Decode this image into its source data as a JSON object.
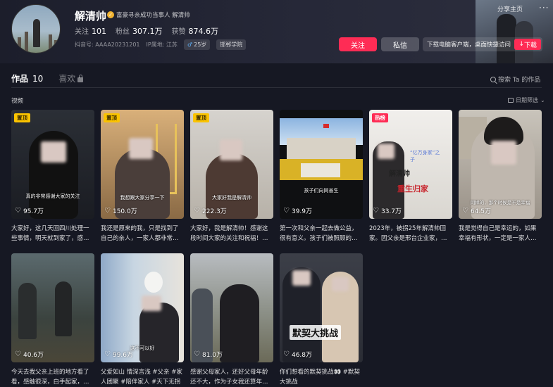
{
  "profile": {
    "name": "解清帅",
    "verified_text": "寻亲成功当事人 解清帅",
    "verified_prefix": "富豪寻亲成功当事人 解清帅",
    "follow_label": "关注",
    "follow_count": "101",
    "fans_label": "粉丝",
    "fans_count": "307.1万",
    "likes_label": "获赞",
    "likes_count": "874.6万",
    "douyin_id": "抖音号: AAAA20231201",
    "ip_location": "IP属地: 江苏",
    "age_tag": "25岁",
    "school_tag": "邯郸学院"
  },
  "actions": {
    "follow_button": "关注",
    "message_button": "私信",
    "download_text": "下载电脑客户端，桌面快捷访问",
    "download_button": "下载",
    "share_home": "分享主页",
    "more": "···"
  },
  "tabs": {
    "works_label": "作品",
    "works_count": "10",
    "likes_label": "喜欢",
    "search_placeholder": "搜索 Ta 的作品"
  },
  "section": {
    "label": "视频",
    "date_filter": "日期筛选"
  },
  "videos": [
    {
      "badge": "置顶",
      "likes": "95.7万",
      "desc": "大家好，这几天回四川处理一些事情，明天就到家了，感…",
      "subtitle": "真的非常感谢大家的关注"
    },
    {
      "badge": "置顶",
      "likes": "150.0万",
      "desc": "我还是原来的我，只是找到了自己的亲人，一家人都非常…",
      "subtitle": "我想跟大家分享一下"
    },
    {
      "badge": "置顶",
      "likes": "222.3万",
      "desc": "大家好，我是解清帅！感谢这段时间大家的关注和祝福！…",
      "subtitle": "大家好我是解清帅"
    },
    {
      "badge": "",
      "likes": "39.9万",
      "desc": "第一次和父亲一起去做公益，很有意义。孩子们被照顾的…",
      "subtitle": "孩子们向同善生"
    },
    {
      "badge": "热榜",
      "likes": "33.7万",
      "desc": "2023年，被拐25年解清帅回家。因父亲是邢台企业家，…",
      "overlay_name": "解清帅",
      "overlay_tag": "“亿万身家”之子",
      "overlay_title": "重生归家"
    },
    {
      "badge": "",
      "likes": "64.5万",
      "desc": "我是觉得自己是幸运的，如果幸福有形状，一定是一家人…",
      "subtitle": "同样的，那个时候是不是幸福"
    },
    {
      "badge": "",
      "likes": "40.6万",
      "desc": "今天去我父亲上班的地方看了看，感触很深，白手起家，…",
      "subtitle": ""
    },
    {
      "badge": "",
      "likes": "99.6万",
      "desc": "父爱如山 情深言浅 #父亲 #家人团聚 #陪伴家人 #天下无拐",
      "subtitle": "这不可以好"
    },
    {
      "badge": "",
      "likes": "81.0万",
      "desc": "感谢父母家人，还好父母年龄还不大，作为子女我还算年…",
      "subtitle": ""
    },
    {
      "badge": "",
      "likes": "46.8万",
      "desc": "你们想看的默契挑战👀 #默契大挑战",
      "overlay_title": "默契大挑战"
    }
  ],
  "colors": {
    "background": "#161823",
    "accent": "#fe2c55",
    "pin_badge": "#fac300"
  }
}
